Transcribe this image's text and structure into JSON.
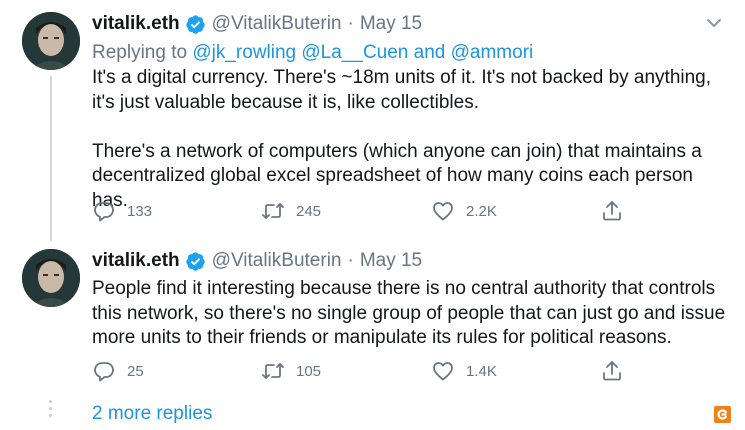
{
  "tweets": [
    {
      "name": "vitalik.eth",
      "handle": "@VitalikButerin",
      "separator": "·",
      "date": "May 15",
      "reply_prefix": "Replying to",
      "reply_targets": "@jk_rowling @La__Cuen and @ammori",
      "text": "It's a digital currency. There's ~18m units of it. It's not backed by anything, it's just valuable because it is, like collectibles.\n\nThere's a network of computers (which anyone can join) that maintains a decentralized global excel spreadsheet of how many coins each person has.",
      "replies": "133",
      "retweets": "245",
      "likes": "2.2K"
    },
    {
      "name": "vitalik.eth",
      "handle": "@VitalikButerin",
      "separator": "·",
      "date": "May 15",
      "text": "People find it interesting because there is no central authority that controls this network, so there's no single group of people that can just go and issue more units to their friends or manipulate its rules for political reasons.",
      "replies": "25",
      "retweets": "105",
      "likes": "1.4K"
    }
  ],
  "more_replies": "2 more replies",
  "icons": {
    "verified": "verified-badge-icon",
    "caret": "chevron-down-icon",
    "reply": "reply-icon",
    "retweet": "retweet-icon",
    "like": "heart-icon",
    "share": "share-icon",
    "watermark": "watermark-logo-icon"
  },
  "colors": {
    "accent": "#1b95e0",
    "muted": "#657786",
    "text": "#14171a",
    "watermark": "#f0811a"
  }
}
